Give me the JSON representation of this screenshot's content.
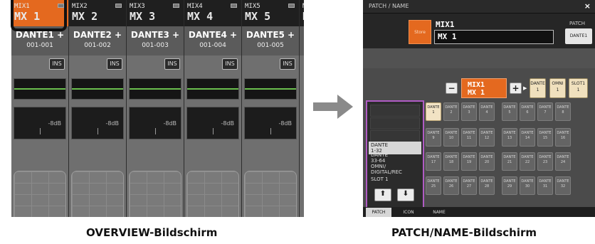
{
  "overview": {
    "channels": [
      {
        "mix": "MIX1",
        "name": "MX 1",
        "port": "DANTE1 +",
        "range": "001-001",
        "ins": "INS",
        "level": "-8dB",
        "selected": true
      },
      {
        "mix": "MIX2",
        "name": "MX 2",
        "port": "DANTE2 +",
        "range": "001-002",
        "ins": "INS",
        "level": "-8dB",
        "selected": false
      },
      {
        "mix": "MIX3",
        "name": "MX 3",
        "port": "DANTE3 +",
        "range": "001-003",
        "ins": "INS",
        "level": "-8dB",
        "selected": false
      },
      {
        "mix": "MIX4",
        "name": "MX 4",
        "port": "DANTE4 +",
        "range": "001-004",
        "ins": "INS",
        "level": "-8dB",
        "selected": false
      },
      {
        "mix": "MIX5",
        "name": "MX 5",
        "port": "DANTE5 +",
        "range": "001-005",
        "ins": "INS",
        "level": "-8dB",
        "selected": false
      },
      {
        "mix": "M",
        "name": "N",
        "port": "",
        "range": "",
        "ins": "",
        "level": "",
        "selected": false
      }
    ]
  },
  "patch": {
    "title": "PATCH / NAME",
    "close": "×",
    "store": "Store",
    "channel_label": "MIX1",
    "name_value": "MX 1",
    "patch_label": "PATCH",
    "patch_button": "DANTE1",
    "selector": {
      "minus": "−",
      "plus": "+",
      "line1": "MIX1",
      "line2": "MX 1"
    },
    "assigned": [
      {
        "top": "DANTE",
        "bottom": "1"
      },
      {
        "top": "OMNI",
        "bottom": "1"
      },
      {
        "top": "SLOT1",
        "bottom": "1"
      }
    ],
    "categories": [
      "DANTE\n1-32",
      "DANTE\n33-64",
      "OMNI/\nDIGITAL/REC",
      "SLOT 1"
    ],
    "active_category": 0,
    "grid_label": "DANTE",
    "grid": [
      "1",
      "2",
      "3",
      "4",
      "5",
      "6",
      "7",
      "8",
      "9",
      "10",
      "11",
      "12",
      "13",
      "14",
      "15",
      "16",
      "17",
      "18",
      "19",
      "20",
      "21",
      "22",
      "23",
      "24",
      "25",
      "26",
      "27",
      "28",
      "29",
      "30",
      "31",
      "32"
    ],
    "selected_port": "1",
    "tabs": [
      "PATCH",
      "ICON",
      "NAME"
    ],
    "active_tab": "PATCH"
  },
  "captions": {
    "left": "OVERVIEW-Bildschirm",
    "right": "PATCH/NAME-Bildschirm"
  },
  "colors": {
    "accent": "#e4691f",
    "selected_port": "#f2e3c4",
    "category_frame": "#b05bc4"
  }
}
